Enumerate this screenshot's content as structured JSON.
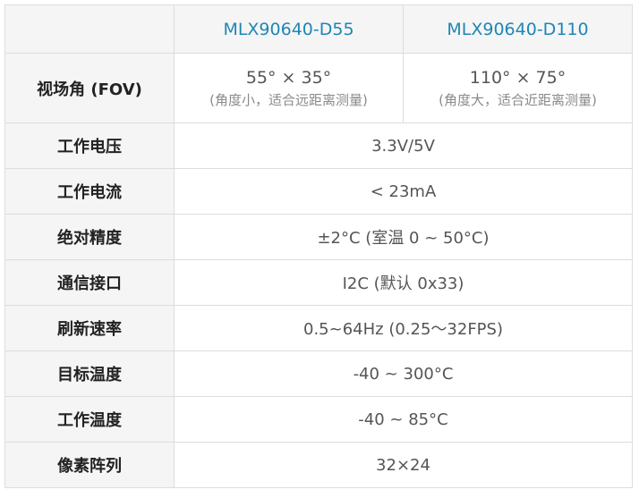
{
  "header": {
    "col_a": "MLX90640-D55",
    "col_b": "MLX90640-D110"
  },
  "fov": {
    "label": "视场角 (FOV)",
    "a_main": "55° × 35°",
    "a_note": "(角度小，适合远距离测量)",
    "b_main": "110° × 75°",
    "b_note": "(角度大，适合近距离测量)"
  },
  "rows": [
    {
      "label": "工作电压",
      "value": "3.3V/5V"
    },
    {
      "label": "工作电流",
      "value": "< 23mA"
    },
    {
      "label": "绝对精度",
      "value": "±2°C (室温 0 ~ 50°C)"
    },
    {
      "label": "通信接口",
      "value": "I2C (默认 0x33)"
    },
    {
      "label": "刷新速率",
      "value": "0.5~64Hz (0.25～32FPS)"
    },
    {
      "label": "目标温度",
      "value": "-40 ~ 300°C"
    },
    {
      "label": "工作温度",
      "value": "-40 ~ 85°C"
    },
    {
      "label": "像素阵列",
      "value": "32×24"
    }
  ],
  "colors": {
    "header_text": "#1f86b5",
    "label_bg": "#f5f5f5",
    "border": "#dcdcdc"
  }
}
